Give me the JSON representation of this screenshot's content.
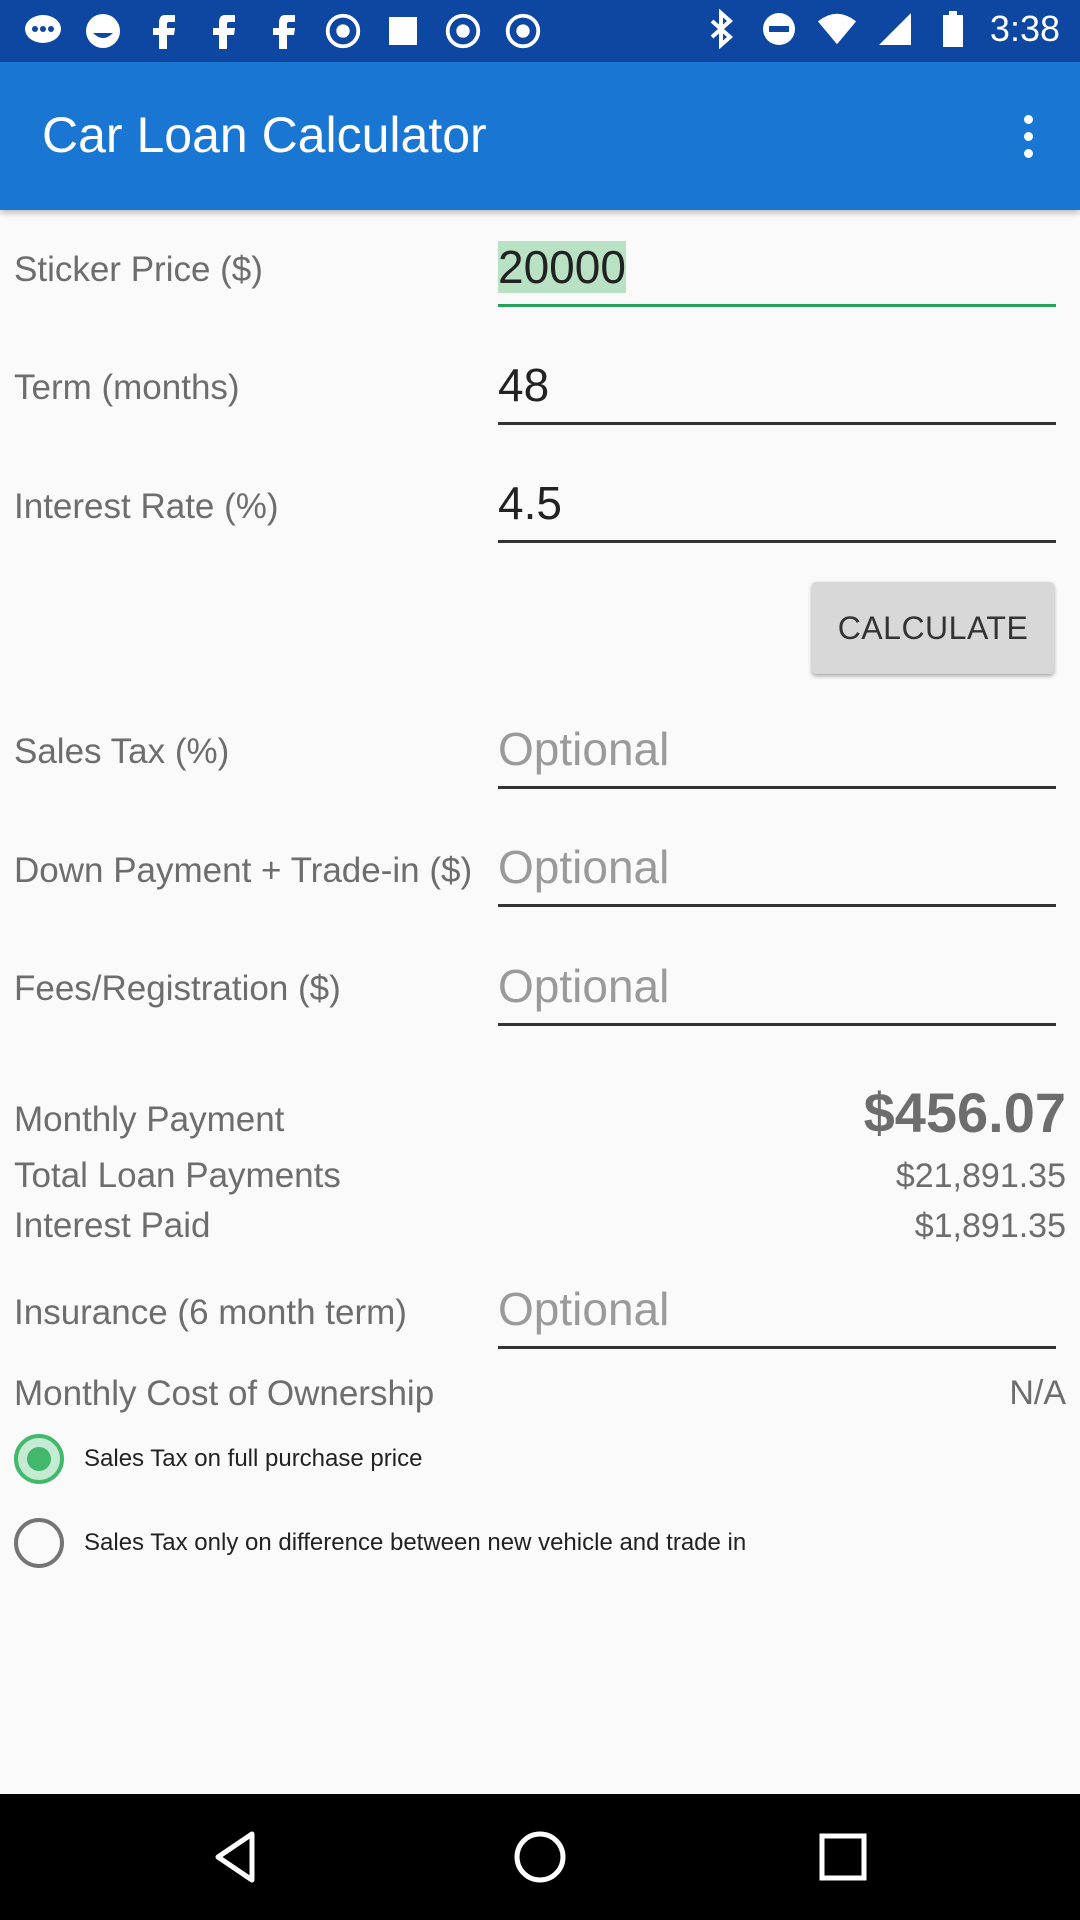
{
  "status_bar": {
    "time": "3:38",
    "icons": [
      "messages-icon",
      "emoji-icon",
      "facebook-icon",
      "facebook-icon",
      "facebook-icon",
      "abc13-icon",
      "square-icon",
      "abc13-icon",
      "abc13-icon",
      "bluetooth-icon",
      "mute-icon",
      "wifi-icon",
      "signal-icon",
      "battery-icon"
    ]
  },
  "app_bar": {
    "title": "Car Loan Calculator",
    "menu_icon": "more-vert-icon"
  },
  "form": {
    "sticker_price": {
      "label": "Sticker Price ($)",
      "value": "20000"
    },
    "term": {
      "label": "Term (months)",
      "value": "48"
    },
    "interest_rate": {
      "label": "Interest Rate (%)",
      "value": "4.5"
    },
    "calculate_label": "CALCULATE",
    "sales_tax": {
      "label": "Sales Tax (%)",
      "placeholder": "Optional"
    },
    "down_payment": {
      "label": "Down Payment + Trade-in ($)",
      "placeholder": "Optional"
    },
    "fees": {
      "label": "Fees/Registration ($)",
      "placeholder": "Optional"
    }
  },
  "results": {
    "monthly_payment": {
      "label": "Monthly Payment",
      "value": "$456.07"
    },
    "total_loan_payments": {
      "label": "Total Loan Payments",
      "value": "$21,891.35"
    },
    "interest_paid": {
      "label": "Interest Paid",
      "value": "$1,891.35"
    }
  },
  "insurance": {
    "label": "Insurance (6 month term)",
    "placeholder": "Optional"
  },
  "ownership": {
    "label": "Monthly Cost of Ownership",
    "value": "N/A"
  },
  "options": [
    {
      "label": "Sales Tax on full purchase price",
      "selected": true
    },
    {
      "label": "Sales Tax only on difference between new vehicle and trade in",
      "selected": false
    }
  ],
  "colors": {
    "status_bar": "#0d47a1",
    "app_bar": "#1976d2",
    "accent": "#41b86b"
  },
  "nav_bar": {
    "icons": [
      "back-icon",
      "home-icon",
      "recents-icon"
    ]
  }
}
